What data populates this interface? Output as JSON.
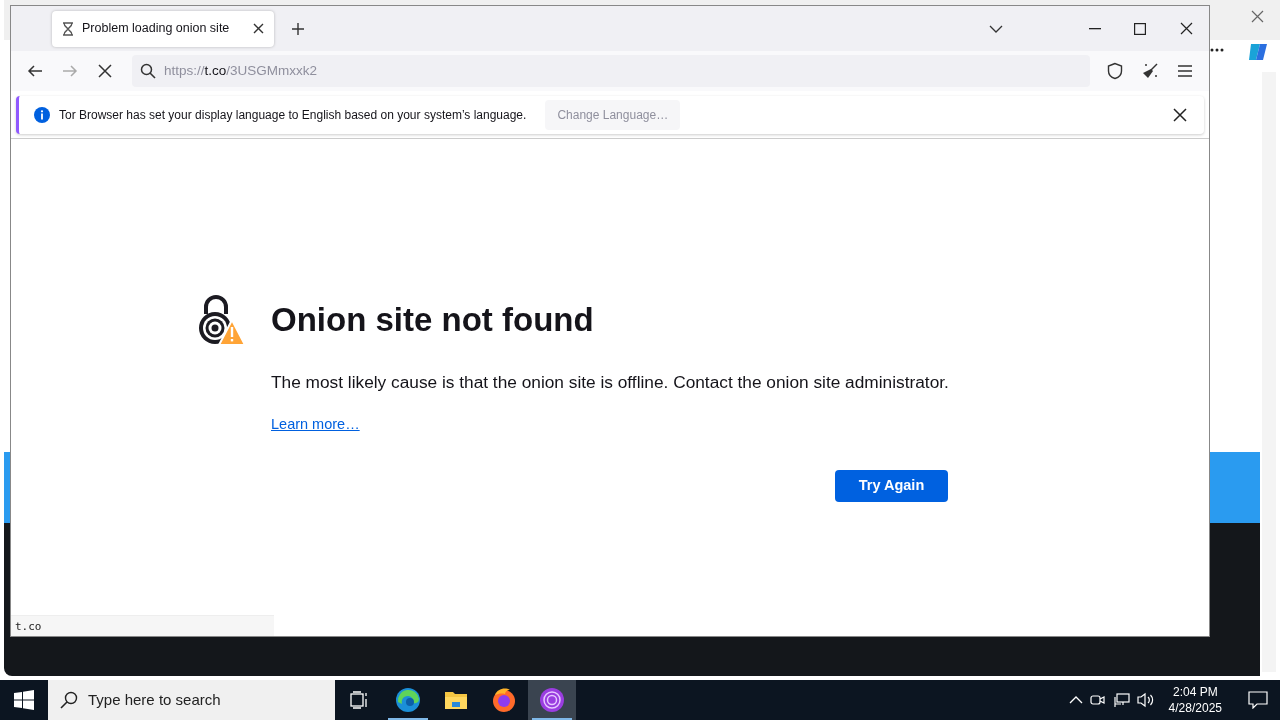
{
  "browser": {
    "tabs": [
      {
        "title": "Problem loading onion site",
        "selected": true,
        "loading": true
      }
    ],
    "url": {
      "scheme": "https://",
      "host": "t.co",
      "path": "/3USGMmxxk2"
    },
    "notification": {
      "message": "Tor Browser has set your display language to English based on your system’s language.",
      "button": "Change Language…"
    },
    "error": {
      "title": "Onion site not found",
      "message": "The most likely cause is that the onion site is offline. Contact the onion site administrator.",
      "link": "Learn more…",
      "button": "Try Again"
    },
    "status_text": "t.co"
  },
  "taskbar": {
    "search_placeholder": "Type here to search",
    "apps": [
      {
        "kind": "taskview",
        "running": false,
        "selected": false
      },
      {
        "kind": "edge",
        "running": true,
        "selected": false
      },
      {
        "kind": "explorer",
        "running": false,
        "selected": false
      },
      {
        "kind": "firefox",
        "running": false,
        "selected": false
      },
      {
        "kind": "tor",
        "running": true,
        "selected": true
      }
    ],
    "time": "2:04 PM",
    "date": "4/28/2025"
  }
}
